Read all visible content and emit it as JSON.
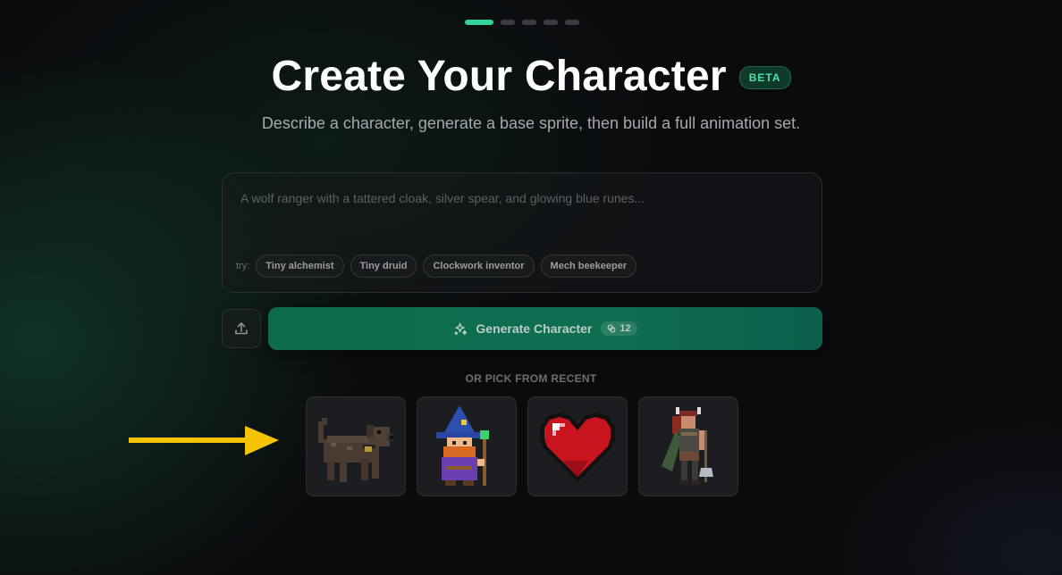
{
  "steps": {
    "total": 5,
    "active": 1
  },
  "header": {
    "title": "Create Your Character",
    "badge": "BETA",
    "subtitle": "Describe a character, generate a base sprite, then build a full animation set."
  },
  "prompt": {
    "value": "",
    "placeholder": "A wolf ranger with a tattered cloak, silver spear, and glowing blue runes...",
    "try_label": "try:",
    "suggestions": [
      "Tiny alchemist",
      "Tiny druid",
      "Clockwork inventor",
      "Mech beekeeper"
    ]
  },
  "actions": {
    "upload_icon": "upload-icon",
    "generate_label": "Generate Character",
    "generate_icon": "sparkles-icon",
    "credit_icon": "credit-icon",
    "credit_cost": "12"
  },
  "recent": {
    "label": "OR PICK FROM RECENT",
    "items": [
      {
        "icon": "dog-sprite"
      },
      {
        "icon": "wizard-sprite"
      },
      {
        "icon": "heart-sprite"
      },
      {
        "icon": "warrior-sprite"
      }
    ]
  },
  "colors": {
    "accent": "#35d29a",
    "generate_button": "#0f6e52",
    "annotation_arrow": "#f5c400",
    "background": "#0b0b0e"
  }
}
